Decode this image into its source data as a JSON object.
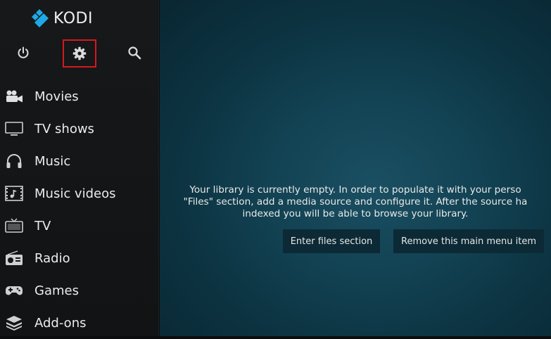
{
  "app": {
    "name": "KODI",
    "accent": "#1ea8e6"
  },
  "top_icons": [
    {
      "name": "power-icon"
    },
    {
      "name": "gear-icon",
      "highlight_color": "#d6181d"
    },
    {
      "name": "search-icon"
    }
  ],
  "menu": {
    "items": [
      {
        "label": "Movies",
        "icon": "movies-icon"
      },
      {
        "label": "TV shows",
        "icon": "tv-shows-icon"
      },
      {
        "label": "Music",
        "icon": "headphones-icon"
      },
      {
        "label": "Music videos",
        "icon": "music-videos-icon"
      },
      {
        "label": "TV",
        "icon": "tv-icon"
      },
      {
        "label": "Radio",
        "icon": "radio-icon"
      },
      {
        "label": "Games",
        "icon": "gamepad-icon"
      },
      {
        "label": "Add-ons",
        "icon": "addons-icon"
      }
    ]
  },
  "main": {
    "message_lines": [
      "Your library is currently empty. In order to populate it with your perso",
      "\"Files\" section, add a media source and configure it. After the source ha",
      "indexed you will be able to browse your library."
    ],
    "enter_files_label": "Enter files section",
    "remove_item_label": "Remove this main menu item"
  }
}
